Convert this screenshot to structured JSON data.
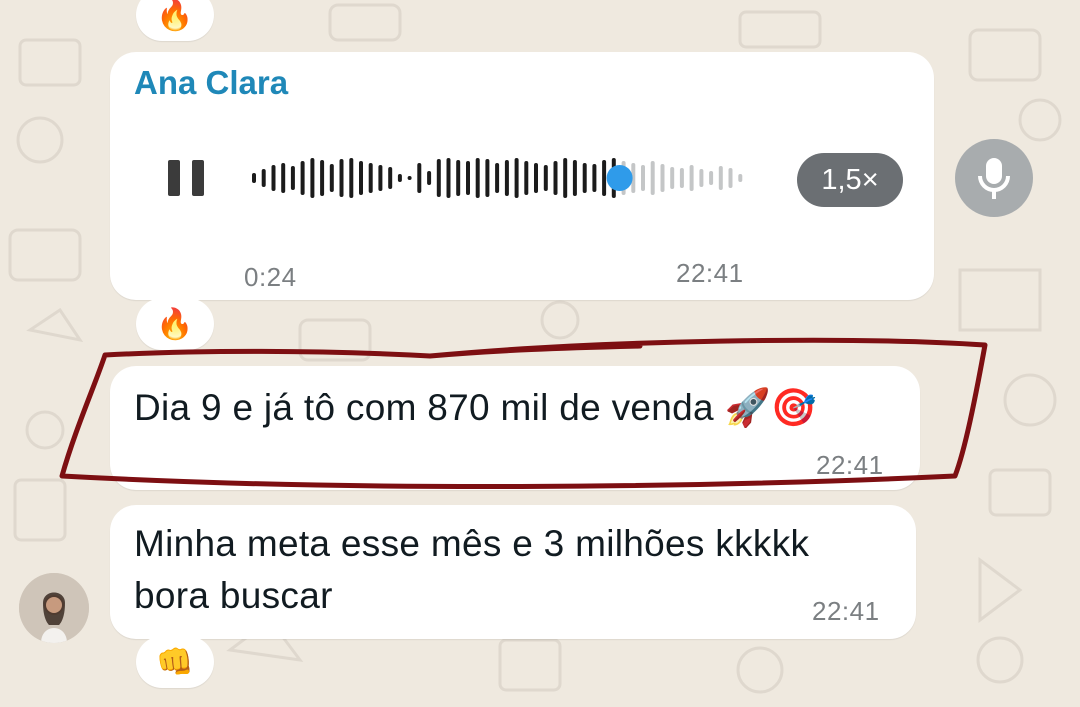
{
  "voice_message": {
    "sender": "Ana Clara",
    "elapsed": "0:24",
    "time": "22:41",
    "speed": "1,5×",
    "progress": 0.74,
    "reaction": "🔥"
  },
  "top_reaction": "🔥",
  "messages": [
    {
      "text": "Dia 9 e já tô com 870 mil de venda 🚀🎯",
      "time": "22:41"
    },
    {
      "line1": "Minha meta esse mês e 3 milhões kkkkk",
      "line2": "bora buscar",
      "time": "22:41",
      "reaction": "👊"
    }
  ],
  "icons": {
    "pause": "pause-icon",
    "mic": "microphone-icon"
  },
  "colors": {
    "wallpaper": "#efe9df",
    "sender_name": "#1f88b8",
    "progress_dot": "#2f9bea",
    "highlight_ring": "#7d0f12"
  }
}
